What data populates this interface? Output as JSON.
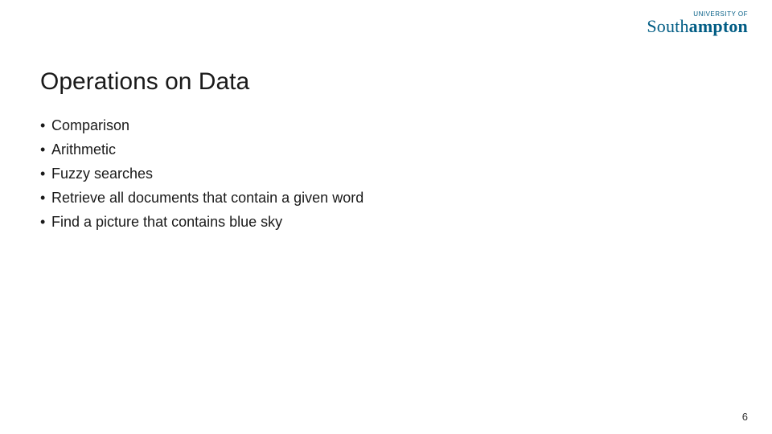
{
  "logo": {
    "top": "UNIVERSITY OF",
    "main_prefix": "South",
    "main_bold": "ampton"
  },
  "title": "Operations on Data",
  "bullets": [
    "Comparison",
    "Arithmetic",
    "Fuzzy searches",
    "Retrieve all documents that contain a given word",
    "Find a picture that contains blue sky"
  ],
  "page_number": "6"
}
